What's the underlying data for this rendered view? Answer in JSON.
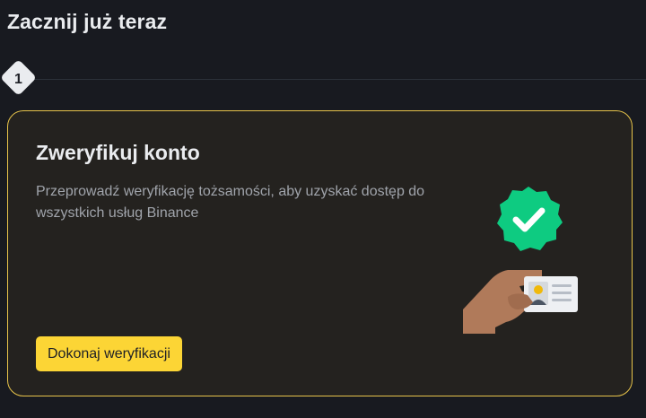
{
  "header": {
    "title": "Zacznij już teraz"
  },
  "steps": [
    {
      "number": "1"
    }
  ],
  "card": {
    "title": "Zweryfikuj konto",
    "description": "Przeprowadź weryfikację tożsamości, aby uzyskać dostęp do wszystkich usług Binance",
    "button_label": "Dokonaj weryfikacji"
  },
  "colors": {
    "background": "#181a20",
    "card_background": "#24221f",
    "card_border": "#e6c34a",
    "accent": "#fcd535",
    "badge_green": "#0ecb81"
  },
  "icons": {
    "step_badge": "diamond-badge-icon",
    "illustration": "verified-id-card-icon"
  }
}
